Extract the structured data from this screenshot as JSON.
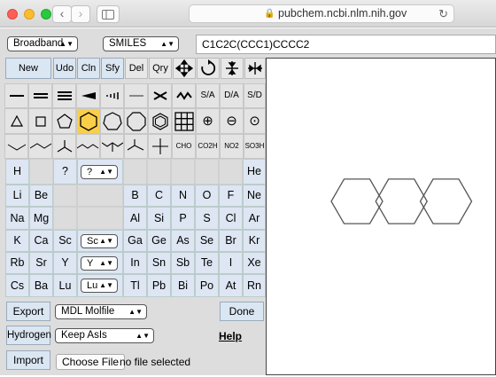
{
  "browser": {
    "url": "pubchem.ncbi.nlm.nih.gov",
    "back_icon": "chevron-left-icon",
    "forward_icon": "chevron-right-icon"
  },
  "toolbar": {
    "mode_select": "Broadband",
    "format_select": "SMILES",
    "smiles_value": "C1C2C(CCC1)CCCC2"
  },
  "edit_tools": [
    "New",
    "Udo",
    "Cln",
    "Sfy",
    "Del",
    "Qry"
  ],
  "bond_labels": [
    "S/A",
    "D/A",
    "S/D"
  ],
  "ring_labels": [],
  "group_labels": {
    "cho": "CHO",
    "co2h": "CO2H",
    "no2": "NO2",
    "so3h": "SO3H"
  },
  "elements": {
    "row1": [
      "H",
      "",
      "?",
      "",
      "",
      "",
      "",
      "",
      "",
      "He"
    ],
    "query_select": "?",
    "row2": [
      "Li",
      "Be",
      "",
      "",
      "B",
      "C",
      "N",
      "O",
      "F",
      "Ne"
    ],
    "row3": [
      "Na",
      "Mg",
      "",
      "",
      "Al",
      "Si",
      "P",
      "S",
      "Cl",
      "Ar"
    ],
    "row4": [
      "K",
      "Ca",
      "Sc",
      "",
      "Ga",
      "Ge",
      "As",
      "Se",
      "Br",
      "Kr"
    ],
    "row4_select": "Sc",
    "row5": [
      "Rb",
      "Sr",
      "Y",
      "",
      "In",
      "Sn",
      "Sb",
      "Te",
      "I",
      "Xe"
    ],
    "row5_select": "Y",
    "row6": [
      "Cs",
      "Ba",
      "Lu",
      "",
      "Tl",
      "Pb",
      "Bi",
      "Po",
      "At",
      "Rn"
    ],
    "row6_select": "Lu"
  },
  "bottom": {
    "export_label": "Export",
    "export_format": "MDL Molfile",
    "done_label": "Done",
    "hydrogen_label": "Hydrogen",
    "hydrogen_option": "Keep AsIs",
    "help_label": "Help",
    "import_label": "Import",
    "choose_file_label": "Choose File",
    "file_status": "no file selected"
  }
}
